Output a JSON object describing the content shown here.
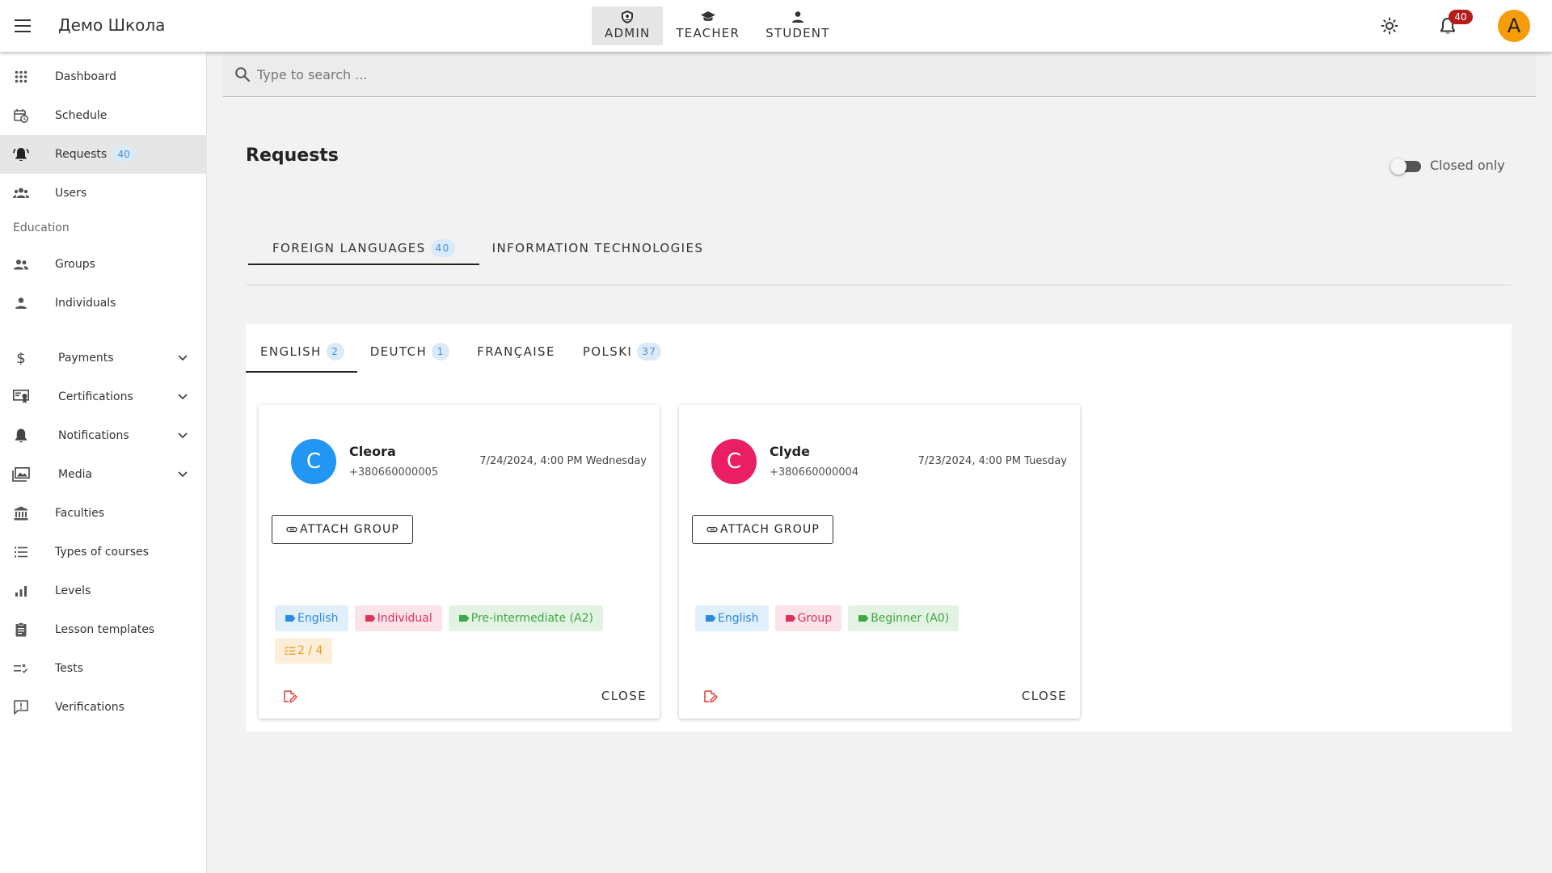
{
  "app": {
    "title": "Демо Школа"
  },
  "roles": [
    {
      "label": "ADMIN",
      "icon": "shield-icon",
      "active": true
    },
    {
      "label": "TEACHER",
      "icon": "graduation-cap-icon",
      "active": false
    },
    {
      "label": "STUDENT",
      "icon": "person-icon",
      "active": false
    }
  ],
  "topbar": {
    "notifications_count": "40",
    "avatar_letter": "A",
    "avatar_color": "#f59b0c"
  },
  "sidebar": {
    "items": [
      {
        "label": "Dashboard",
        "icon": "grid-icon"
      },
      {
        "label": "Schedule",
        "icon": "calendar-clock-icon"
      },
      {
        "label": "Requests",
        "icon": "bell-ring-icon",
        "count": "40",
        "active": true
      },
      {
        "label": "Users",
        "icon": "users-icon"
      }
    ],
    "section": "Education",
    "education_items": [
      {
        "label": "Groups",
        "icon": "group-icon"
      },
      {
        "label": "Individuals",
        "icon": "person-icon"
      }
    ],
    "expandable_items": [
      {
        "label": "Payments",
        "icon": "dollar-icon"
      },
      {
        "label": "Certifications",
        "icon": "certificate-icon"
      },
      {
        "label": "Notifications",
        "icon": "bell-icon"
      },
      {
        "label": "Media",
        "icon": "images-icon"
      }
    ],
    "more_items": [
      {
        "label": "Faculties",
        "icon": "building-icon"
      },
      {
        "label": "Types of courses",
        "icon": "list-icon"
      },
      {
        "label": "Levels",
        "icon": "bar-chart-icon"
      },
      {
        "label": "Lesson templates",
        "icon": "clipboard-icon"
      },
      {
        "label": "Tests",
        "icon": "checklist-icon"
      },
      {
        "label": "Verifications",
        "icon": "comment-alert-icon"
      }
    ]
  },
  "search": {
    "placeholder": "Type to search ..."
  },
  "page": {
    "title": "Requests",
    "toggle_label": "Closed only",
    "toggle_on": false
  },
  "category_tabs": [
    {
      "label": "FOREIGN LANGUAGES",
      "count": "40",
      "active": true
    },
    {
      "label": "INFORMATION TECHNOLOGIES",
      "active": false
    }
  ],
  "language_tabs": [
    {
      "label": "ENGLISH",
      "count": "2",
      "active": true
    },
    {
      "label": "DEUTCH",
      "count": "1",
      "active": false
    },
    {
      "label": "FRANÇAISE",
      "active": false
    },
    {
      "label": "POLSKI",
      "count": "37",
      "active": false
    }
  ],
  "cards": [
    {
      "initial": "C",
      "avatar_color": "#2196f3",
      "name": "Cleora",
      "phone": "+380660000005",
      "date": "7/24/2024, 4:00 PM Wednesday",
      "attach_label": "ATTACH GROUP",
      "chips": [
        {
          "label": "English",
          "color": "blue",
          "icon": "tag-icon"
        },
        {
          "label": "Individual",
          "color": "red",
          "icon": "tag-icon"
        },
        {
          "label": "Pre-intermediate (A2)",
          "color": "green",
          "icon": "tag-icon"
        },
        {
          "label": "2 / 4",
          "color": "orange",
          "icon": "list-check-icon"
        }
      ],
      "close_label": "CLOSE"
    },
    {
      "initial": "C",
      "avatar_color": "#e91e63",
      "name": "Clyde",
      "phone": "+380660000004",
      "date": "7/23/2024, 4:00 PM Tuesday",
      "attach_label": "ATTACH GROUP",
      "chips": [
        {
          "label": "English",
          "color": "blue",
          "icon": "tag-icon"
        },
        {
          "label": "Group",
          "color": "red",
          "icon": "tag-icon"
        },
        {
          "label": "Beginner (A0)",
          "color": "green",
          "icon": "tag-icon"
        }
      ],
      "close_label": "CLOSE"
    }
  ]
}
